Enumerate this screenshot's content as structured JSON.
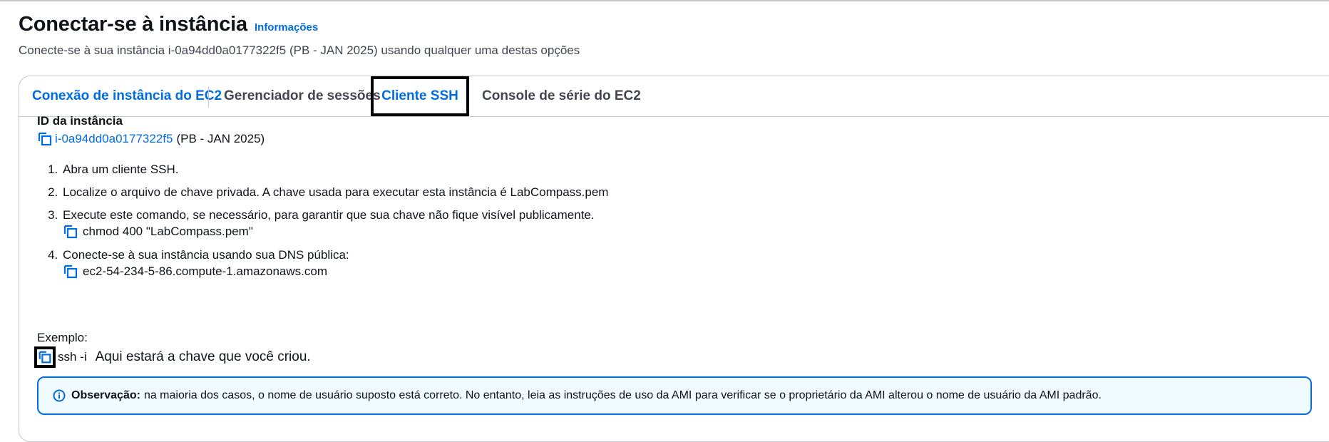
{
  "header": {
    "title": "Conectar-se à instância",
    "info_link": "Informações",
    "subtitle": "Conecte-se à sua instância i-0a94dd0a0177322f5 (PB - JAN 2025) usando qualquer uma destas opções"
  },
  "tabs": [
    {
      "label": "Conexão de instância do EC2"
    },
    {
      "label": "Gerenciador de sessões"
    },
    {
      "label": "Cliente SSH"
    },
    {
      "label": "Console de série do EC2"
    }
  ],
  "instance": {
    "label": "ID da instância",
    "id": "i-0a94dd0a0177322f5",
    "suffix": "(PB - JAN 2025)"
  },
  "steps": [
    {
      "text": "Abra um cliente SSH."
    },
    {
      "text": "Localize o arquivo de chave privada. A chave usada para executar esta instância é LabCompass.pem"
    },
    {
      "text": "Execute este comando, se necessário, para garantir que sua chave não fique visível publicamente.",
      "command": "chmod 400 \"LabCompass.pem\""
    },
    {
      "text": "Conecte-se à sua instância usando sua DNS pública:",
      "command": "ec2-54-234-5-86.compute-1.amazonaws.com"
    }
  ],
  "example": {
    "label": "Exemplo:",
    "command": "ssh -i",
    "note": "Aqui estará a chave que você criou."
  },
  "alert": {
    "title": "Observação:",
    "text": "na maioria dos casos, o nome de usuário suposto está correto. No entanto, leia as instruções de uso da AMI para verificar se o proprietário da AMI alterou o nome de usuário da AMI padrão."
  },
  "colors": {
    "link": "#006ce0",
    "text": "#0f141a",
    "secondary_text": "#424650",
    "border": "#c6c6cd",
    "alert_bg": "#f0fbff"
  }
}
